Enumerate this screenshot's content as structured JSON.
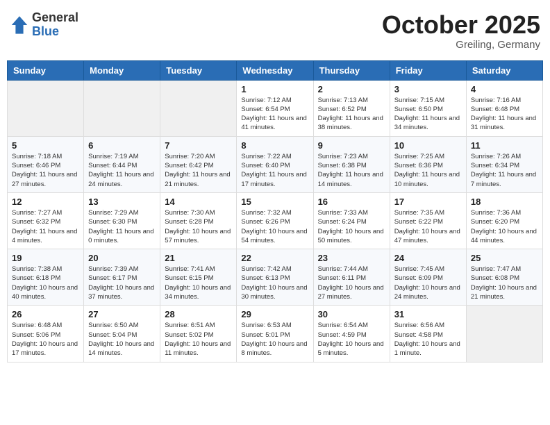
{
  "header": {
    "logo_general": "General",
    "logo_blue": "Blue",
    "month_title": "October 2025",
    "subtitle": "Greiling, Germany"
  },
  "weekdays": [
    "Sunday",
    "Monday",
    "Tuesday",
    "Wednesday",
    "Thursday",
    "Friday",
    "Saturday"
  ],
  "weeks": [
    [
      {
        "day": "",
        "info": ""
      },
      {
        "day": "",
        "info": ""
      },
      {
        "day": "",
        "info": ""
      },
      {
        "day": "1",
        "info": "Sunrise: 7:12 AM\nSunset: 6:54 PM\nDaylight: 11 hours\nand 41 minutes."
      },
      {
        "day": "2",
        "info": "Sunrise: 7:13 AM\nSunset: 6:52 PM\nDaylight: 11 hours\nand 38 minutes."
      },
      {
        "day": "3",
        "info": "Sunrise: 7:15 AM\nSunset: 6:50 PM\nDaylight: 11 hours\nand 34 minutes."
      },
      {
        "day": "4",
        "info": "Sunrise: 7:16 AM\nSunset: 6:48 PM\nDaylight: 11 hours\nand 31 minutes."
      }
    ],
    [
      {
        "day": "5",
        "info": "Sunrise: 7:18 AM\nSunset: 6:46 PM\nDaylight: 11 hours\nand 27 minutes."
      },
      {
        "day": "6",
        "info": "Sunrise: 7:19 AM\nSunset: 6:44 PM\nDaylight: 11 hours\nand 24 minutes."
      },
      {
        "day": "7",
        "info": "Sunrise: 7:20 AM\nSunset: 6:42 PM\nDaylight: 11 hours\nand 21 minutes."
      },
      {
        "day": "8",
        "info": "Sunrise: 7:22 AM\nSunset: 6:40 PM\nDaylight: 11 hours\nand 17 minutes."
      },
      {
        "day": "9",
        "info": "Sunrise: 7:23 AM\nSunset: 6:38 PM\nDaylight: 11 hours\nand 14 minutes."
      },
      {
        "day": "10",
        "info": "Sunrise: 7:25 AM\nSunset: 6:36 PM\nDaylight: 11 hours\nand 10 minutes."
      },
      {
        "day": "11",
        "info": "Sunrise: 7:26 AM\nSunset: 6:34 PM\nDaylight: 11 hours\nand 7 minutes."
      }
    ],
    [
      {
        "day": "12",
        "info": "Sunrise: 7:27 AM\nSunset: 6:32 PM\nDaylight: 11 hours\nand 4 minutes."
      },
      {
        "day": "13",
        "info": "Sunrise: 7:29 AM\nSunset: 6:30 PM\nDaylight: 11 hours\nand 0 minutes."
      },
      {
        "day": "14",
        "info": "Sunrise: 7:30 AM\nSunset: 6:28 PM\nDaylight: 10 hours\nand 57 minutes."
      },
      {
        "day": "15",
        "info": "Sunrise: 7:32 AM\nSunset: 6:26 PM\nDaylight: 10 hours\nand 54 minutes."
      },
      {
        "day": "16",
        "info": "Sunrise: 7:33 AM\nSunset: 6:24 PM\nDaylight: 10 hours\nand 50 minutes."
      },
      {
        "day": "17",
        "info": "Sunrise: 7:35 AM\nSunset: 6:22 PM\nDaylight: 10 hours\nand 47 minutes."
      },
      {
        "day": "18",
        "info": "Sunrise: 7:36 AM\nSunset: 6:20 PM\nDaylight: 10 hours\nand 44 minutes."
      }
    ],
    [
      {
        "day": "19",
        "info": "Sunrise: 7:38 AM\nSunset: 6:18 PM\nDaylight: 10 hours\nand 40 minutes."
      },
      {
        "day": "20",
        "info": "Sunrise: 7:39 AM\nSunset: 6:17 PM\nDaylight: 10 hours\nand 37 minutes."
      },
      {
        "day": "21",
        "info": "Sunrise: 7:41 AM\nSunset: 6:15 PM\nDaylight: 10 hours\nand 34 minutes."
      },
      {
        "day": "22",
        "info": "Sunrise: 7:42 AM\nSunset: 6:13 PM\nDaylight: 10 hours\nand 30 minutes."
      },
      {
        "day": "23",
        "info": "Sunrise: 7:44 AM\nSunset: 6:11 PM\nDaylight: 10 hours\nand 27 minutes."
      },
      {
        "day": "24",
        "info": "Sunrise: 7:45 AM\nSunset: 6:09 PM\nDaylight: 10 hours\nand 24 minutes."
      },
      {
        "day": "25",
        "info": "Sunrise: 7:47 AM\nSunset: 6:08 PM\nDaylight: 10 hours\nand 21 minutes."
      }
    ],
    [
      {
        "day": "26",
        "info": "Sunrise: 6:48 AM\nSunset: 5:06 PM\nDaylight: 10 hours\nand 17 minutes."
      },
      {
        "day": "27",
        "info": "Sunrise: 6:50 AM\nSunset: 5:04 PM\nDaylight: 10 hours\nand 14 minutes."
      },
      {
        "day": "28",
        "info": "Sunrise: 6:51 AM\nSunset: 5:02 PM\nDaylight: 10 hours\nand 11 minutes."
      },
      {
        "day": "29",
        "info": "Sunrise: 6:53 AM\nSunset: 5:01 PM\nDaylight: 10 hours\nand 8 minutes."
      },
      {
        "day": "30",
        "info": "Sunrise: 6:54 AM\nSunset: 4:59 PM\nDaylight: 10 hours\nand 5 minutes."
      },
      {
        "day": "31",
        "info": "Sunrise: 6:56 AM\nSunset: 4:58 PM\nDaylight: 10 hours\nand 1 minute."
      },
      {
        "day": "",
        "info": ""
      }
    ]
  ]
}
